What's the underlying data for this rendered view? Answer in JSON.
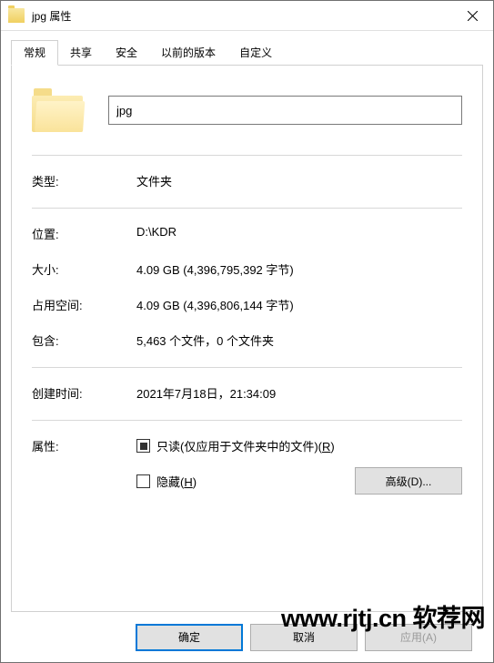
{
  "title": "jpg 属性",
  "tabs": [
    "常规",
    "共享",
    "安全",
    "以前的版本",
    "自定义"
  ],
  "name_value": "jpg",
  "props": {
    "type_label": "类型:",
    "type_value": "文件夹",
    "location_label": "位置:",
    "location_value": "D:\\KDR",
    "size_label": "大小:",
    "size_value": "4.09 GB (4,396,795,392 字节)",
    "disk_label": "占用空间:",
    "disk_value": "4.09 GB (4,396,806,144 字节)",
    "contains_label": "包含:",
    "contains_value": "5,463 个文件，0 个文件夹",
    "created_label": "创建时间:",
    "created_value": "2021年7月18日，21:34:09",
    "attr_label": "属性:"
  },
  "readonly": {
    "prefix": "只读(仅应用于文件夹中的文件)(",
    "hotkey": "R",
    "suffix": ")"
  },
  "hidden": {
    "prefix": "隐藏(",
    "hotkey": "H",
    "suffix": ")"
  },
  "advanced": {
    "prefix": "高级(",
    "hotkey": "D",
    "suffix": ")..."
  },
  "buttons": {
    "ok": "确定",
    "cancel": "取消",
    "apply_prefix": "应用(",
    "apply_hotkey": "A",
    "apply_suffix": ")"
  },
  "watermark": "www.rjtj.cn 软荐网"
}
